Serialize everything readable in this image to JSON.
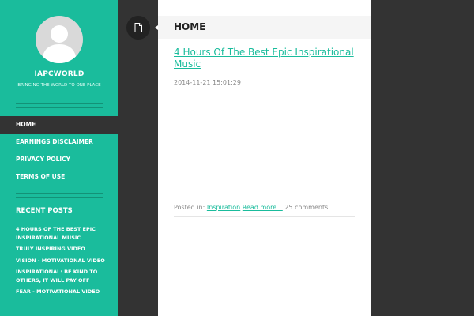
{
  "site": {
    "title": "IAPCWORLD",
    "description": "BRINGING THE WORLD TO ONE PLACE"
  },
  "nav": {
    "items": [
      {
        "label": "HOME",
        "active": true
      },
      {
        "label": "EARNINGS DISCLAIMER"
      },
      {
        "label": "PRIVACY POLICY"
      },
      {
        "label": "TERMS OF USE"
      }
    ]
  },
  "recent": {
    "title": "RECENT POSTS",
    "items": [
      "4 HOURS OF THE BEST EPIC INSPIRATIONAL MUSIC",
      "TRULY INSPIRING VIDEO",
      "VISION - MOTIVATIONAL VIDEO",
      "INSPIRATIONAL: BE KIND TO OTHERS, IT WILL PAY OFF",
      "FEAR - MOTIVATIONAL VIDEO"
    ]
  },
  "page": {
    "title": "HOME",
    "icon": "document-icon"
  },
  "post": {
    "title": "4 Hours Of The Best Epic Inspirational Music",
    "date": "2014-11-21 15:01:29",
    "posted_in_label": "Posted in:",
    "category": "Inspiration",
    "read_more": "Read more...",
    "comments": "25 comments"
  },
  "colors": {
    "accent": "#1abc9c",
    "dark": "#333333",
    "content_bg": "#ffffff"
  }
}
